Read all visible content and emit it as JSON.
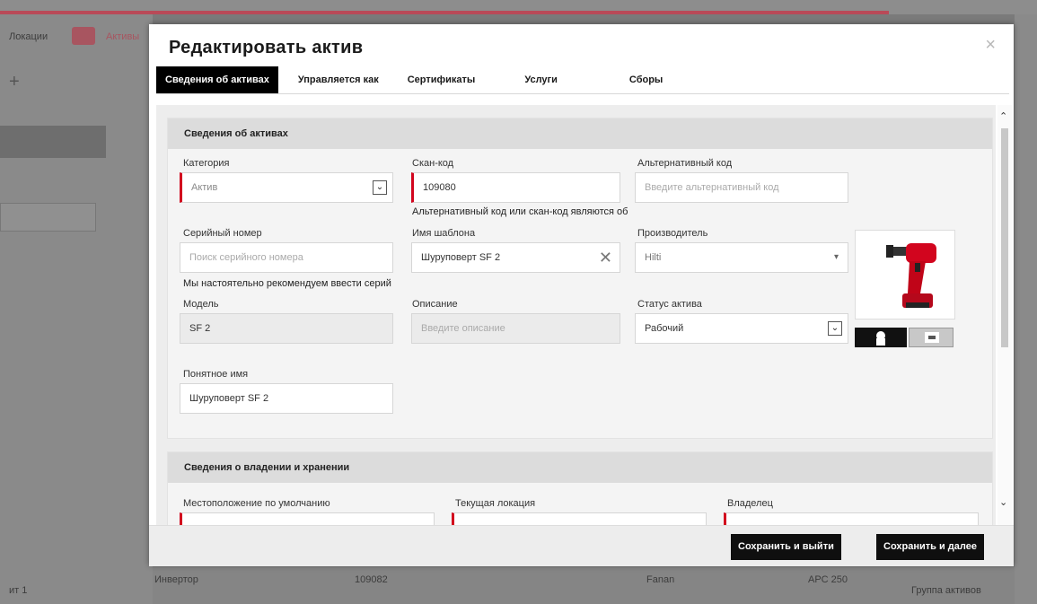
{
  "background": {
    "left_items": [
      "Локации",
      "Активы"
    ],
    "bottom_row": [
      "Инвертор",
      "109082",
      "Fanan",
      "APC 250",
      "Группа активов"
    ],
    "bottom_left": "ит 1"
  },
  "modal": {
    "title": "Редактировать актив",
    "close_label": "×",
    "tabs": [
      {
        "label": "Сведения об активах",
        "active": true
      },
      {
        "label": "Управляется как",
        "active": false
      },
      {
        "label": "Сертификаты",
        "active": false
      },
      {
        "label": "Услуги",
        "active": false
      },
      {
        "label": "Сборы",
        "active": false
      }
    ],
    "section_info": {
      "title": "Сведения об активах",
      "category": {
        "label": "Категория",
        "value": "Актив"
      },
      "scan_code": {
        "label": "Скан-код",
        "value": "109080",
        "hint": "Альтернативный код или скан-код являются обязательными"
      },
      "alt_code": {
        "label": "Альтернативный код",
        "placeholder": "Введите альтернативный код"
      },
      "serial": {
        "label": "Серийный номер",
        "placeholder": "Поиск серийного номера",
        "note": "Мы настоятельно рекомендуем ввести серийный номер"
      },
      "template": {
        "label": "Имя шаблона",
        "value": "Шуруповерт SF 2"
      },
      "manufacturer": {
        "label": "Производитель",
        "value": "Hilti"
      },
      "model": {
        "label": "Модель",
        "value": "SF 2"
      },
      "description": {
        "label": "Описание",
        "placeholder": "Введите описание"
      },
      "status": {
        "label": "Статус актива",
        "value": "Рабочий"
      },
      "friendly_name": {
        "label": "Понятное имя",
        "value": "Шуруповерт SF 2"
      }
    },
    "section_ownership": {
      "title": "Сведения о владении и хранении",
      "default_location": "Местоположение по умолчанию",
      "current_location": "Текущая локация",
      "owner": "Владелец"
    },
    "buttons": {
      "save_exit": "Сохранить и выйти",
      "save_next": "Сохранить и далее"
    }
  },
  "colors": {
    "accent": "#d2051e",
    "dark": "#0f0f0f"
  }
}
